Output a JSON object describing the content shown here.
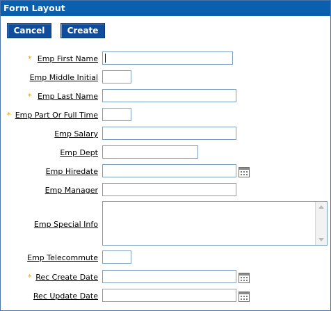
{
  "window": {
    "title": "Form Layout"
  },
  "toolbar": {
    "cancel_label": "Cancel",
    "create_label": "Create"
  },
  "required_marker": "*",
  "fields": {
    "emp_first_name": {
      "label": "Emp First Name",
      "value": "",
      "required": true
    },
    "emp_middle_initial": {
      "label": "Emp Middle Initial",
      "value": "",
      "required": false
    },
    "emp_last_name": {
      "label": "Emp Last Name",
      "value": "",
      "required": true
    },
    "emp_part_or_full_time": {
      "label": "Emp Part Or Full Time",
      "value": "",
      "required": true
    },
    "emp_salary": {
      "label": "Emp Salary",
      "value": "",
      "required": false
    },
    "emp_dept": {
      "label": "Emp Dept",
      "value": "",
      "required": false
    },
    "emp_hiredate": {
      "label": "Emp Hiredate",
      "value": "",
      "required": false
    },
    "emp_manager": {
      "label": "Emp Manager",
      "value": "",
      "required": false
    },
    "emp_special_info": {
      "label": "Emp Special Info",
      "value": "",
      "required": false
    },
    "emp_telecommute": {
      "label": "Emp Telecommute",
      "value": "",
      "required": false
    },
    "rec_create_date": {
      "label": "Rec Create Date",
      "value": "",
      "required": true
    },
    "rec_update_date": {
      "label": "Rec Update Date",
      "value": "",
      "required": false
    }
  },
  "icons": {
    "date_picker": "calendar-icon"
  },
  "colors": {
    "title_bar": "#0a5fae",
    "button": "#0f4d9c",
    "required": "#e3a300",
    "field_border": "#7b9ebd"
  }
}
